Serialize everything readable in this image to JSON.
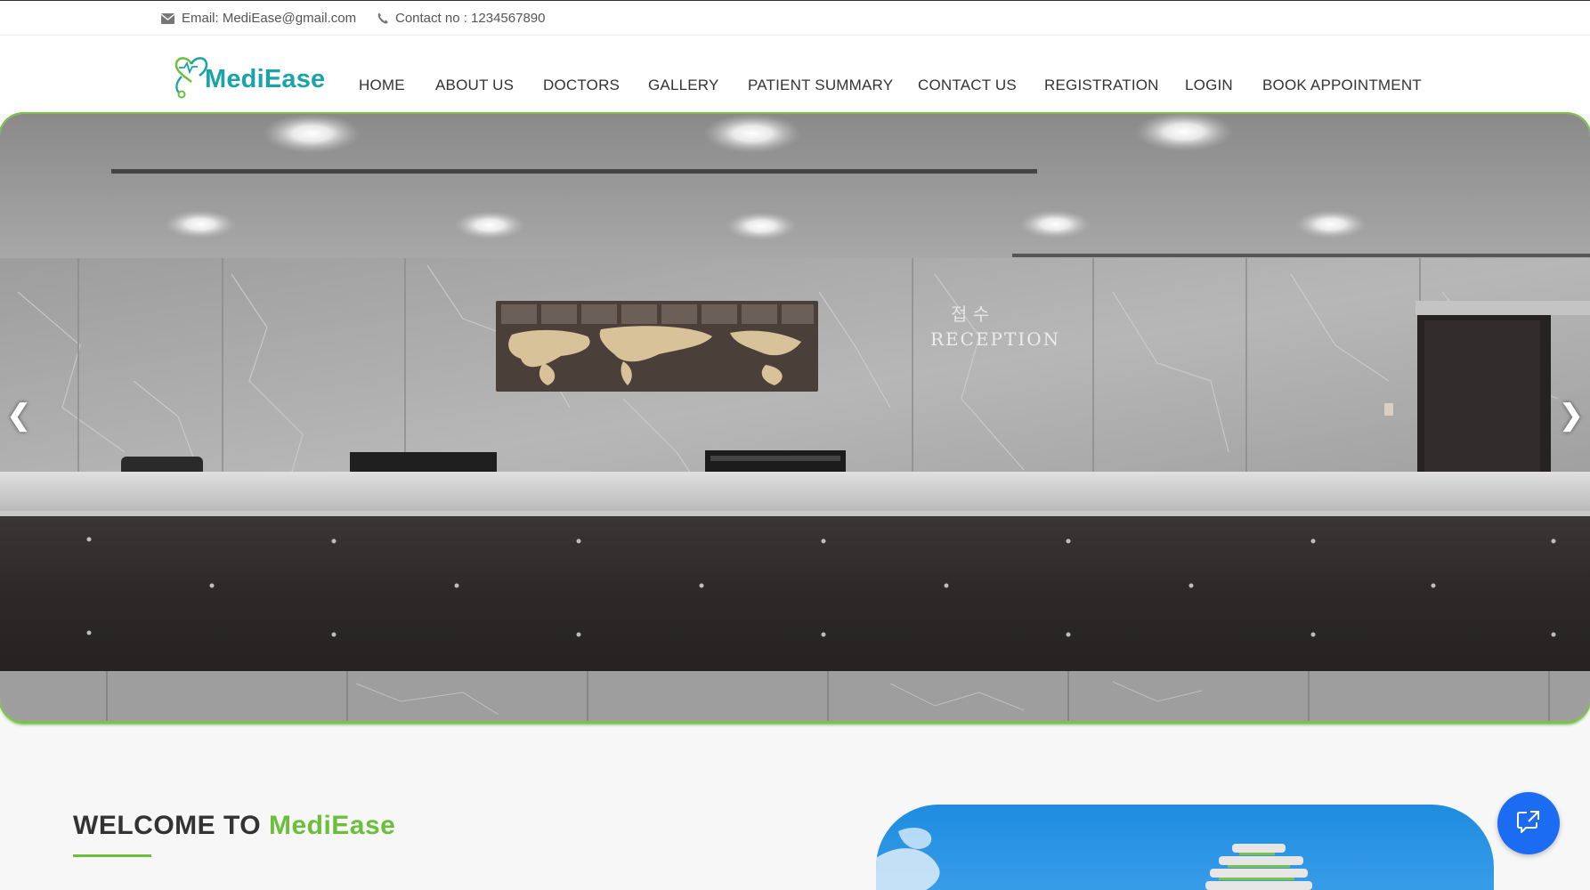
{
  "topbar": {
    "email_text": "Email: MediEase@gmail.com",
    "phone_text": "Contact no : 1234567890"
  },
  "brand": {
    "logo_text": "MediEase",
    "primary_color": "#1aa3a8",
    "accent_color": "#6abf3b"
  },
  "nav": {
    "items": [
      {
        "label": "HOME"
      },
      {
        "label": "ABOUT US"
      },
      {
        "label": "DOCTORS"
      },
      {
        "label": "GALLERY"
      },
      {
        "label": "PATIENT SUMMARY"
      },
      {
        "label": "CONTACT US"
      },
      {
        "label": "REGISTRATION"
      },
      {
        "label": "LOGIN"
      },
      {
        "label": "BOOK APPOINTMENT"
      }
    ]
  },
  "slider": {
    "prev_glyph": "❮",
    "next_glyph": "❯",
    "sign_korean": "접 수",
    "sign_text": "RECEPTION"
  },
  "welcome": {
    "prefix": "WELCOME TO ",
    "brand": "MediEase"
  },
  "icons": {
    "email": "envelope-icon",
    "phone": "phone-icon",
    "chat": "chat-icon"
  }
}
